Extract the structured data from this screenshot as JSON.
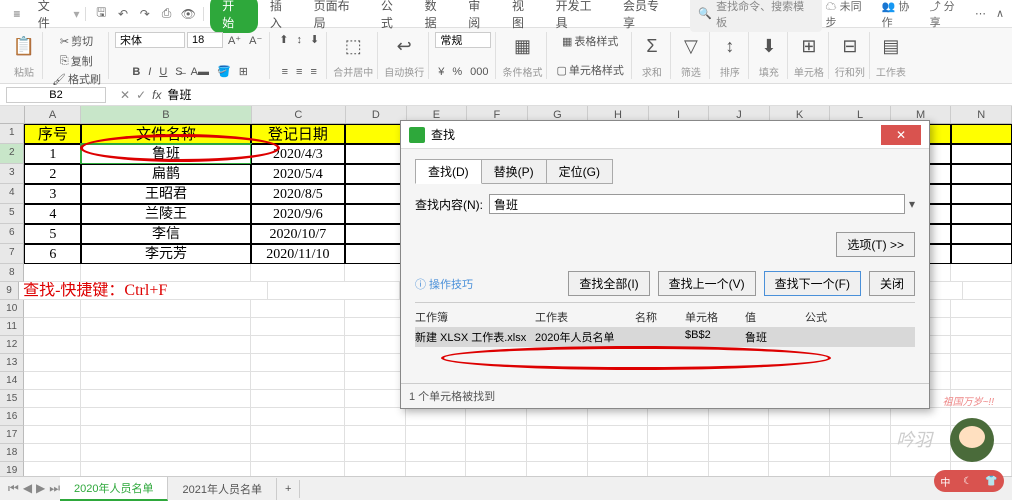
{
  "menubar": {
    "file": "文件",
    "start": "开始",
    "insert": "插入",
    "layout": "页面布局",
    "formula": "公式",
    "data": "数据",
    "review": "审阅",
    "view": "视图",
    "dev": "开发工具",
    "member": "会员专享",
    "search_ph": "查找命令、搜索模板",
    "unsync": "未同步",
    "coop": "协作",
    "share": "分享"
  },
  "ribbon": {
    "paste": "粘贴",
    "cut": "剪切",
    "copy": "复制",
    "fmt": "格式刷",
    "font": "宋体",
    "size": "18",
    "merge": "合并居中",
    "wrap": "自动换行",
    "general": "常规",
    "cond": "条件格式",
    "tblstyle": "表格样式",
    "cellstyle": "单元格样式",
    "sum": "求和",
    "filter": "筛选",
    "sort": "排序",
    "fill": "填充",
    "cellgrp": "单元格",
    "rowcol": "行和列",
    "sheet": "工作表"
  },
  "namebox": "B2",
  "formula": "鲁班",
  "cols": [
    "A",
    "B",
    "C",
    "D",
    "E",
    "F",
    "G",
    "H",
    "I",
    "J",
    "K",
    "L",
    "M",
    "N"
  ],
  "headers": {
    "A": "序号",
    "B": "文件名称",
    "C": "登记日期"
  },
  "rows": [
    {
      "n": "1",
      "a": "1",
      "b": "鲁班",
      "c": "2020/4/3"
    },
    {
      "n": "2",
      "a": "2",
      "b": "扁鹊",
      "c": "2020/5/4"
    },
    {
      "n": "3",
      "a": "3",
      "b": "王昭君",
      "c": "2020/8/5"
    },
    {
      "n": "4",
      "a": "4",
      "b": "兰陵王",
      "c": "2020/9/6"
    },
    {
      "n": "5",
      "a": "5",
      "b": "李信",
      "c": "2020/10/7"
    },
    {
      "n": "6",
      "a": "6",
      "b": "李元芳",
      "c": "2020/11/10"
    }
  ],
  "hint": "查找-快捷键：Ctrl+F",
  "dialog": {
    "title": "查找",
    "tabs": {
      "find": "查找(D)",
      "replace": "替换(P)",
      "goto": "定位(G)"
    },
    "label": "查找内容(N):",
    "value": "鲁班",
    "options": "选项(T) >>",
    "tips": "操作技巧",
    "findall": "查找全部(I)",
    "findprev": "查找上一个(V)",
    "findnext": "查找下一个(F)",
    "close": "关闭",
    "res_head": {
      "wb": "工作簿",
      "ws": "工作表",
      "name": "名称",
      "cell": "单元格",
      "val": "值",
      "fm": "公式"
    },
    "res_row": {
      "wb": "新建 XLSX 工作表.xlsx",
      "ws": "2020年人员名单",
      "name": "",
      "cell": "$B$2",
      "val": "鲁班",
      "fm": ""
    },
    "status": "1 个单元格被找到"
  },
  "sheets": {
    "s1": "2020年人员名单",
    "s2": "2021年人员名单"
  },
  "watermark": "吟羽",
  "flag": "祖国万岁~!!"
}
